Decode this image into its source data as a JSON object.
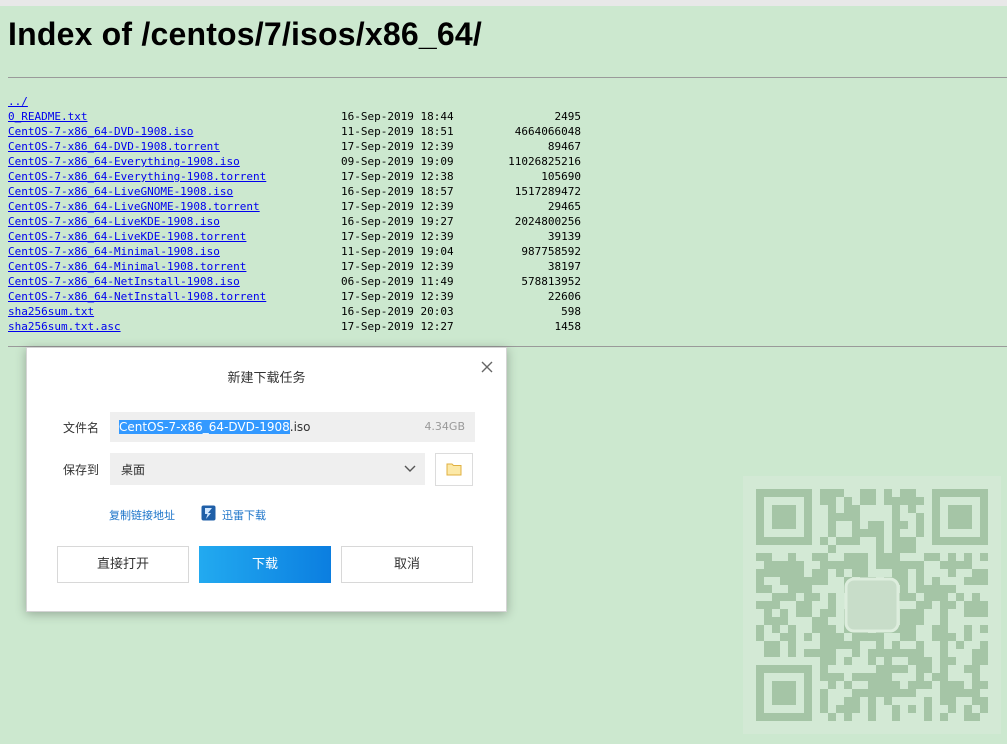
{
  "page": {
    "heading": "Index of /centos/7/isos/x86_64/"
  },
  "listing": [
    {
      "name": "../",
      "date": "",
      "size": ""
    },
    {
      "name": "0_README.txt",
      "date": "16-Sep-2019 18:44",
      "size": "2495"
    },
    {
      "name": "CentOS-7-x86_64-DVD-1908.iso",
      "date": "11-Sep-2019 18:51",
      "size": "4664066048"
    },
    {
      "name": "CentOS-7-x86_64-DVD-1908.torrent",
      "date": "17-Sep-2019 12:39",
      "size": "89467"
    },
    {
      "name": "CentOS-7-x86_64-Everything-1908.iso",
      "date": "09-Sep-2019 19:09",
      "size": "11026825216"
    },
    {
      "name": "CentOS-7-x86_64-Everything-1908.torrent",
      "date": "17-Sep-2019 12:38",
      "size": "105690"
    },
    {
      "name": "CentOS-7-x86_64-LiveGNOME-1908.iso",
      "date": "16-Sep-2019 18:57",
      "size": "1517289472"
    },
    {
      "name": "CentOS-7-x86_64-LiveGNOME-1908.torrent",
      "date": "17-Sep-2019 12:39",
      "size": "29465"
    },
    {
      "name": "CentOS-7-x86_64-LiveKDE-1908.iso",
      "date": "16-Sep-2019 19:27",
      "size": "2024800256"
    },
    {
      "name": "CentOS-7-x86_64-LiveKDE-1908.torrent",
      "date": "17-Sep-2019 12:39",
      "size": "39139"
    },
    {
      "name": "CentOS-7-x86_64-Minimal-1908.iso",
      "date": "11-Sep-2019 19:04",
      "size": "987758592"
    },
    {
      "name": "CentOS-7-x86_64-Minimal-1908.torrent",
      "date": "17-Sep-2019 12:39",
      "size": "38197"
    },
    {
      "name": "CentOS-7-x86_64-NetInstall-1908.iso",
      "date": "06-Sep-2019 11:49",
      "size": "578813952"
    },
    {
      "name": "CentOS-7-x86_64-NetInstall-1908.torrent",
      "date": "17-Sep-2019 12:39",
      "size": "22606"
    },
    {
      "name": "sha256sum.txt",
      "date": "16-Sep-2019 20:03",
      "size": "598"
    },
    {
      "name": "sha256sum.txt.asc",
      "date": "17-Sep-2019 12:27",
      "size": "1458"
    }
  ],
  "dialog": {
    "title": "新建下载任务",
    "filename_label": "文件名",
    "filename_selected": "CentOS-7-x86_64-DVD-1908",
    "filename_ext": ".iso",
    "filesize": "4.34GB",
    "saveto_label": "保存到",
    "saveto_value": "桌面",
    "copy_link": "复制链接地址",
    "thunder": "迅雷下载",
    "btn_open": "直接打开",
    "btn_download": "下载",
    "btn_cancel": "取消",
    "close_icon": "close-icon",
    "folder_icon": "folder-icon",
    "chevron_icon": "chevron-down-icon"
  },
  "colors": {
    "page_bg": "#cce8cf",
    "link": "#0000ee",
    "accent": "#0b7ee0",
    "selection": "#3399ff"
  }
}
